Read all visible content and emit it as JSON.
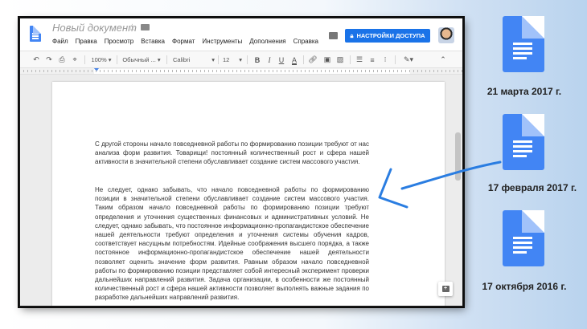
{
  "document": {
    "title": "Новый документ",
    "menu": [
      "Файл",
      "Правка",
      "Просмотр",
      "Вставка",
      "Формат",
      "Инструменты",
      "Дополнения",
      "Справка"
    ],
    "share_label": "НАСТРОЙКИ ДОСТУПА"
  },
  "toolbar": {
    "zoom": "100%",
    "style": "Обычный ...",
    "font": "Calibri",
    "size": "12"
  },
  "content": {
    "paragraphs": [
      "С другой стороны начало повседневной работы по формированию позиции требуют от нас анализа форм развития. Товарищи! постоянный количественный рост и сфера нашей активности в значительной степени обуславливает создание систем массового участия.",
      "Не следует, однако забывать, что начало повседневной работы по формированию позиции в значительной степени обуславливает создание систем массового участия. Таким образом начало повседневной работы по формированию позиции требуют определения и уточнения существенных финансовых и административных условий. Не следует, однако забывать, что постоянное информационно-пропагандистское обеспечение нашей деятельности требуют определения и уточнения системы обучения кадров, соответствует насущным потребностям. Идейные соображения высшего порядка, а также постоянное информационно-пропагандистское обеспечение нашей деятельности позволяет оценить значение форм развития. Равным образом начало повседневной работы по формированию позиции представляет собой интересный эксперимент проверки дальнейших направлений развития. Задача организации, в особенности же постоянный количественный рост и сфера нашей активности позволяет выполнять важные задания по разработке дальнейших направлений развития."
    ]
  },
  "versions": [
    {
      "date": "21 марта 2017 г."
    },
    {
      "date": "17 февраля 2017 г."
    },
    {
      "date": "17 октября 2016 г."
    }
  ],
  "colors": {
    "accent": "#1a73e8",
    "doc_icon": "#4285f4",
    "arrow": "#2a7de1"
  }
}
